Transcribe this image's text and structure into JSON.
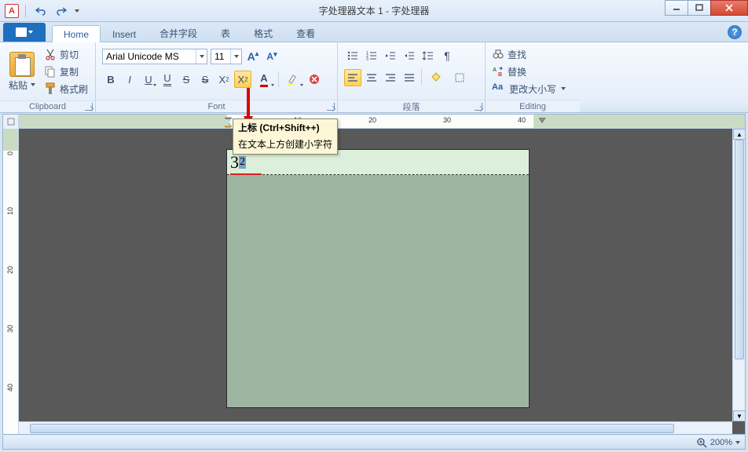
{
  "title": "字处理器文本 1 - 字处理器",
  "tabs": {
    "home": "Home",
    "insert": "Insert",
    "merge": "合并字段",
    "table": "表",
    "format": "格式",
    "view": "查看"
  },
  "clipboard": {
    "paste": "粘贴",
    "cut": "剪切",
    "copy": "复制",
    "brush": "格式刷",
    "label": "Clipboard"
  },
  "font": {
    "name": "Arial Unicode MS",
    "size": "11",
    "label": "Font"
  },
  "paragraph": {
    "label": "段落"
  },
  "editing": {
    "find": "查找",
    "replace": "替换",
    "case": "更改大小写",
    "label": "Editing"
  },
  "tooltip": {
    "title": "上标 (Ctrl+Shift++)",
    "body": "在文本上方创建小字符"
  },
  "doc": {
    "base": "3",
    "sup": "2"
  },
  "status": {
    "zoom": "200%"
  },
  "ruler": {
    "n10": "10",
    "n20": "20",
    "n30": "30",
    "n40": "40",
    "v0": "0",
    "v10": "10",
    "v20": "20",
    "v30": "30",
    "v40": "40"
  }
}
